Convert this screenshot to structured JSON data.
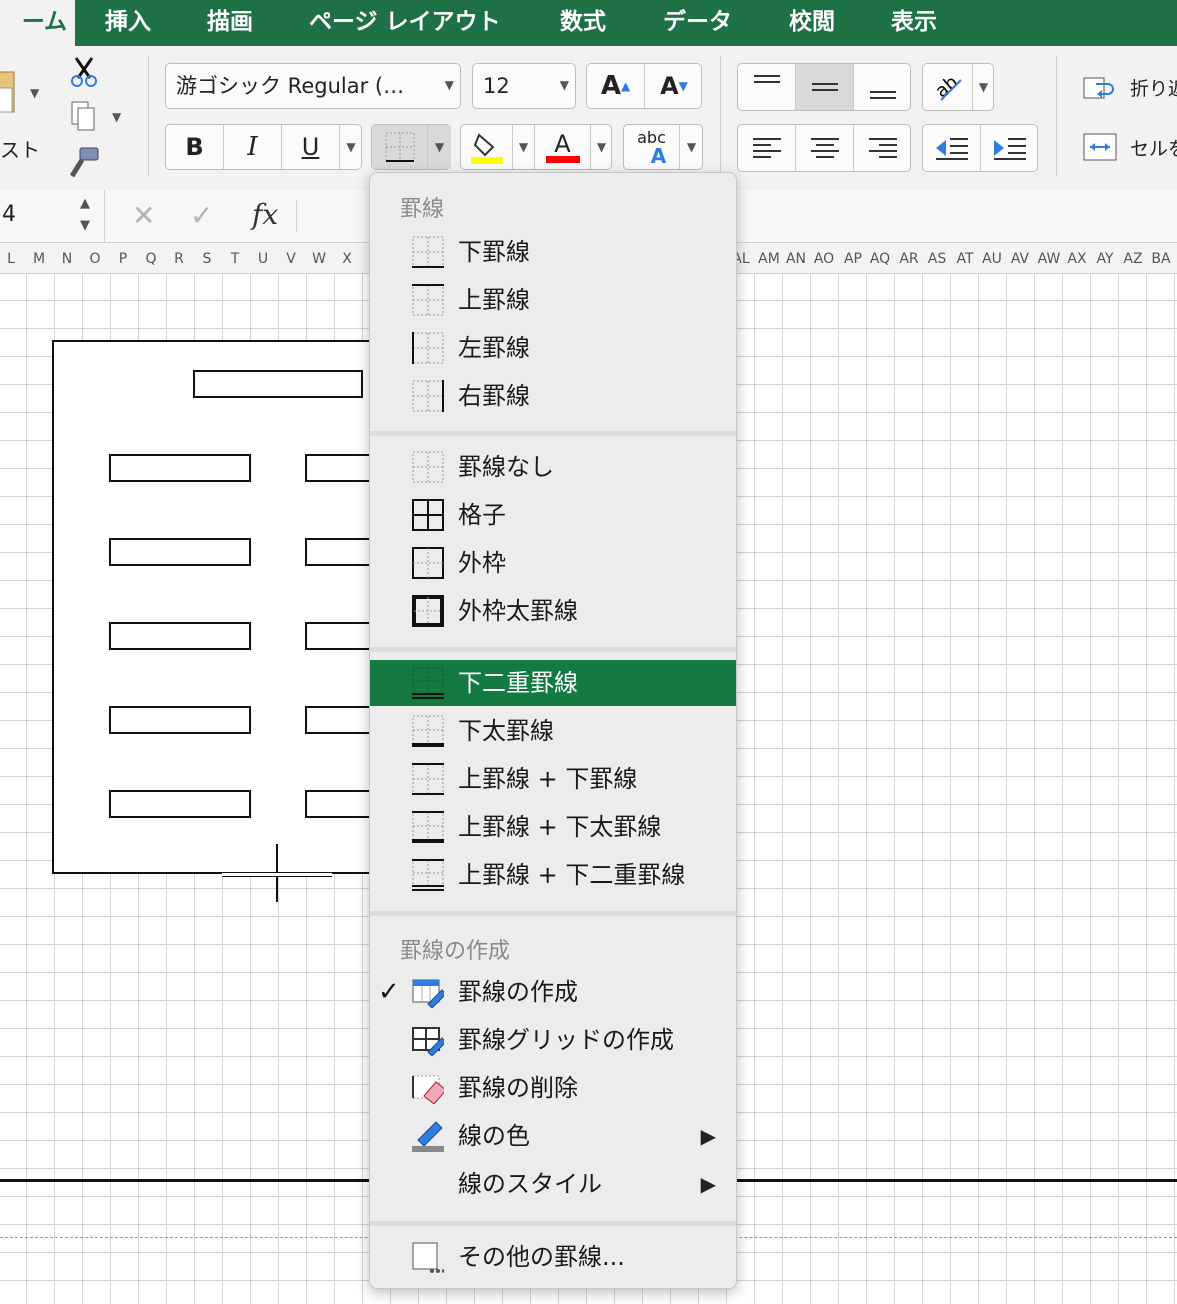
{
  "tabs": [
    {
      "label": "ーム",
      "active": true
    },
    {
      "label": "挿入"
    },
    {
      "label": "描画"
    },
    {
      "label": "ページ レイアウト"
    },
    {
      "label": "数式"
    },
    {
      "label": "データ"
    },
    {
      "label": "校閲"
    },
    {
      "label": "表示"
    }
  ],
  "ribbon": {
    "paste_label": "スト",
    "font_name": "游ゴシック Regular (…",
    "font_size": "12",
    "grow_font": "A",
    "shrink_font": "A",
    "bold": "B",
    "italic": "I",
    "underline": "U",
    "font_color_glyph": "A",
    "text_effects_top": "abc",
    "text_effects_bottom": "A",
    "wrap_text": "折り返",
    "merge_cells": "セルを",
    "colors": {
      "accent": "#1e7145",
      "fill_color": "#ffff00",
      "font_color": "#ff0000",
      "icon_blue": "#2f7de1"
    }
  },
  "formula_bar": {
    "name_box": "4",
    "fx": "fx",
    "cancel": "✕",
    "confirm": "✓"
  },
  "columns": {
    "left": [
      "L",
      "M",
      "N",
      "O",
      "P",
      "Q",
      "R",
      "S",
      "T",
      "U",
      "V",
      "W",
      "X"
    ],
    "right": [
      "AL",
      "AM",
      "AN",
      "AO",
      "AP",
      "AQ",
      "AR",
      "AS",
      "AT",
      "AU",
      "AV",
      "AW",
      "AX",
      "AY",
      "AZ",
      "BA"
    ]
  },
  "menu": {
    "section_borders": "罫線",
    "section_draw": "罫線の作成",
    "items": {
      "bottom": "下罫線",
      "top": "上罫線",
      "left": "左罫線",
      "right": "右罫線",
      "none": "罫線なし",
      "all": "格子",
      "outside": "外枠",
      "thick_outside": "外枠太罫線",
      "bottom_double": "下二重罫線",
      "thick_bottom": "下太罫線",
      "top_bottom": "上罫線 + 下罫線",
      "top_thick_bottom": "上罫線 + 下太罫線",
      "top_double_bottom": "上罫線 + 下二重罫線",
      "draw_border": "罫線の作成",
      "draw_grid": "罫線グリッドの作成",
      "erase_border": "罫線の削除",
      "line_color": "線の色",
      "line_style": "線のスタイル",
      "more_borders": "その他の罫線..."
    },
    "highlighted": "bottom_double",
    "checked": "draw_border",
    "check_glyph": "✓",
    "submenu_arrow": "▶",
    "highlight_color": "#147a41"
  }
}
